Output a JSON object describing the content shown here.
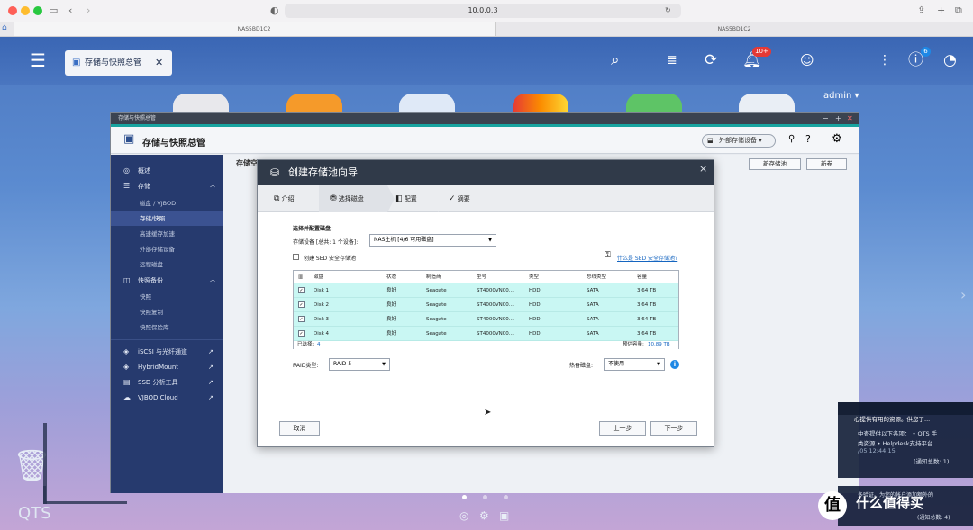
{
  "browser": {
    "url": "10.0.0.3",
    "tabs": [
      "NAS5BD1C2",
      "NAS5BD1C2"
    ]
  },
  "qts_topbar": {
    "app_tab_label": "存储与快照总管",
    "user": "admin",
    "notification_badge": "10+",
    "info_badge": "6"
  },
  "window": {
    "titlebar": "存储与快照总管",
    "header_title": "存储与快照总管",
    "external_storage_button": "外部存储设备",
    "sidebar": [
      {
        "label": "概述",
        "level": 0
      },
      {
        "label": "存储",
        "level": 0
      },
      {
        "label": "磁盘 / VJBOD",
        "level": 1
      },
      {
        "label": "存储/快照",
        "level": 1,
        "active": true
      },
      {
        "label": "高速缓存加速",
        "level": 1
      },
      {
        "label": "外部存储设备",
        "level": 1
      },
      {
        "label": "远程磁盘",
        "level": 1
      },
      {
        "label": "快照备份",
        "level": 0
      },
      {
        "label": "快照",
        "level": 1
      },
      {
        "label": "快照复制",
        "level": 1
      },
      {
        "label": "快照保险库",
        "level": 1
      },
      {
        "label": "iSCSI 与光纤通道",
        "level": 0
      },
      {
        "label": "HybridMount",
        "level": 0
      },
      {
        "label": "SSD 分析工具",
        "level": 0
      },
      {
        "label": "VJBOD Cloud",
        "level": 0
      }
    ],
    "content_title": "存储空",
    "new_pool_button": "新存储池",
    "new_volume_button": "新卷"
  },
  "wizard": {
    "title": "创建存储池向导",
    "close": "×",
    "steps": [
      "介绍",
      "选择磁盘",
      "配置",
      "摘要"
    ],
    "section_title": "选择并配置磁盘：",
    "device_label": "存储设备 [总共: 1 个设备]:",
    "device_value": "NAS主机 [4/6 可用磁盘]",
    "sed_checkbox_label": "创建 SED 安全存储池",
    "sed_link": "什么是 SED 安全存储池?",
    "columns": [
      "磁盘",
      "状态",
      "制造商",
      "型号",
      "类型",
      "总线类型",
      "容量"
    ],
    "disks": [
      {
        "name": "Disk 1",
        "status": "良好",
        "vendor": "Seagate",
        "model": "ST4000VN00...",
        "type": "HDD",
        "bus": "SATA",
        "capacity": "3.64 TB"
      },
      {
        "name": "Disk 2",
        "status": "良好",
        "vendor": "Seagate",
        "model": "ST4000VN00...",
        "type": "HDD",
        "bus": "SATA",
        "capacity": "3.64 TB"
      },
      {
        "name": "Disk 3",
        "status": "良好",
        "vendor": "Seagate",
        "model": "ST4000VN00...",
        "type": "HDD",
        "bus": "SATA",
        "capacity": "3.64 TB"
      },
      {
        "name": "Disk 4",
        "status": "良好",
        "vendor": "Seagate",
        "model": "ST4000VN00...",
        "type": "HDD",
        "bus": "SATA",
        "capacity": "3.64 TB"
      }
    ],
    "selected_label": "已选择:",
    "selected_count": "4",
    "estimated_label": "预估容量:",
    "estimated_value": "10.89 TB",
    "raid_label": "RAID类型:",
    "raid_value": "RAID 5",
    "hotspare_label": "热备磁盘:",
    "hotspare_value": "不使用",
    "cancel_button": "取消",
    "prev_button": "上一步",
    "next_button": "下一步"
  },
  "notifications": {
    "line1": "心提供有用的资源。供您了...",
    "line2": "中查提供以下各项： • QTS 手",
    "line3": "类资源 • Helpdesk支持平台",
    "time": "/05 12:44:15",
    "total": "(通知总数: 1)",
    "line4": "多验证。为您的帐户添加额外的",
    "total2": "(通知总数: 4)"
  },
  "desktop": {
    "qts_label": "QTS",
    "watermark": "值 什么值得买"
  }
}
